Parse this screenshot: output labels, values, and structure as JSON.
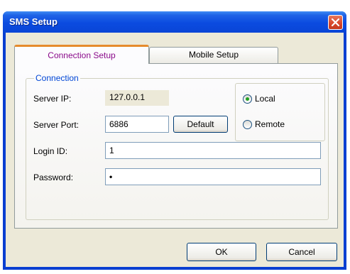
{
  "window": {
    "title": "SMS Setup"
  },
  "tabs": [
    {
      "label": "Connection Setup",
      "active": true
    },
    {
      "label": "Mobile Setup",
      "active": false
    }
  ],
  "connection": {
    "group_label": "Connection",
    "server_ip_label": "Server IP:",
    "server_ip_value": "127.0.0.1",
    "server_port_label": "Server Port:",
    "server_port_value": "6886",
    "default_button": "Default",
    "login_id_label": "Login ID:",
    "login_id_value": "1",
    "password_label": "Password:",
    "password_value": "•",
    "mode": {
      "options": [
        "Local",
        "Remote"
      ],
      "selected": "Local"
    }
  },
  "footer": {
    "ok_label": "OK",
    "cancel_label": "Cancel"
  },
  "colors": {
    "titlebar": "#0a4be0",
    "active_tab_text": "#8a0a8a",
    "group_label": "#0046d5",
    "tab_highlight": "#e68b2c",
    "radio_dot": "#21a121"
  }
}
